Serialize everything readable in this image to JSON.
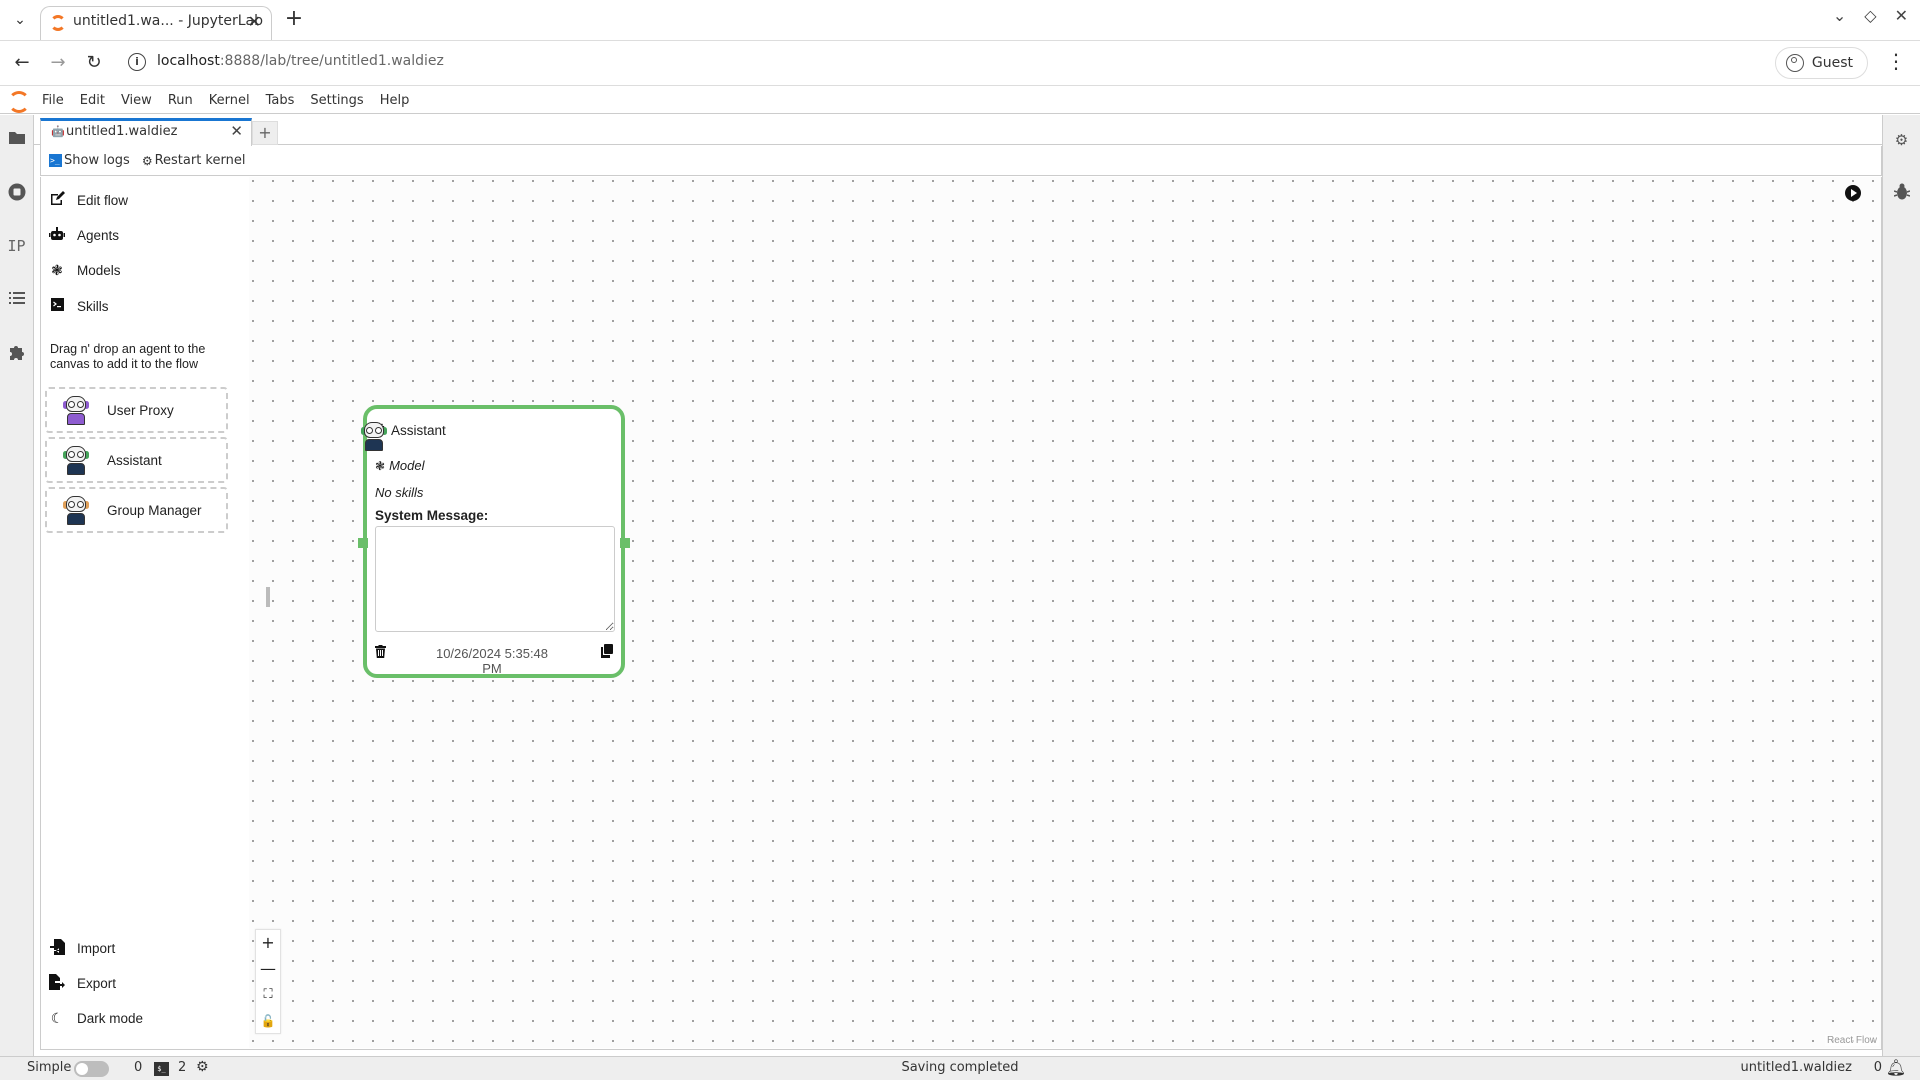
{
  "browser": {
    "tab_title": "untitled1.wa... - JupyterLab",
    "url_host": "localhost",
    "url_rest": ":8888/lab/tree/untitled1.waldiez",
    "profile_label": "Guest",
    "icons": {
      "tab_list": "chevron-down-icon",
      "close_tab": "close-icon",
      "new_tab": "plus-icon",
      "back": "arrow-left-icon",
      "forward": "arrow-right-icon",
      "reload": "reload-icon",
      "site_info": "info-icon",
      "menu": "kebab-menu-icon"
    },
    "window_controls": [
      "minimize-icon",
      "restore-icon",
      "close-icon"
    ]
  },
  "jupyter": {
    "menu": [
      "File",
      "Edit",
      "View",
      "Run",
      "Kernel",
      "Tabs",
      "Settings",
      "Help"
    ],
    "left_sidebar_icons": [
      "folder-icon",
      "stop-circle-icon",
      "ip-icon",
      "list-icon",
      "puzzle-icon"
    ],
    "left_sidebar_ip_text": "IP",
    "right_sidebar_icons": [
      "property-inspector-icon",
      "debugger-icon"
    ],
    "doc_tab": {
      "label": "untitled1.waldiez",
      "add_label": "+"
    },
    "toolbar": {
      "show_logs": "Show logs",
      "restart_kernel": "Restart kernel"
    }
  },
  "waldiez": {
    "sidebar": {
      "items": [
        {
          "label": "Edit flow",
          "icon": "edit-icon"
        },
        {
          "label": "Agents",
          "icon": "robot-icon"
        },
        {
          "label": "Models",
          "icon": "openai-icon"
        },
        {
          "label": "Skills",
          "icon": "terminal-icon"
        }
      ],
      "drag_hint": "Drag n' drop an agent to the canvas to add it to the flow",
      "agents": [
        {
          "label": "User Proxy",
          "accent": "#8e5cd0"
        },
        {
          "label": "Assistant",
          "accent": "#45a35a"
        },
        {
          "label": "Group Manager",
          "accent": "#e0a05a"
        }
      ],
      "bottom_items": [
        {
          "label": "Import",
          "icon": "file-import-icon"
        },
        {
          "label": "Export",
          "icon": "file-export-icon"
        },
        {
          "label": "Dark mode",
          "icon": "moon-icon"
        }
      ]
    },
    "node": {
      "title": "Assistant",
      "model_label": "Model",
      "skills_label": "No skills",
      "system_message_label": "System Message:",
      "system_message_value": "",
      "created": "10/26/2024 5:35:48 PM",
      "border_color": "#6abf69"
    },
    "zoom_controls": [
      "zoom-in-icon",
      "zoom-out-icon",
      "fit-view-icon",
      "lock-icon"
    ],
    "attribution": "React Flow"
  },
  "statusbar": {
    "mode_label": "Simple",
    "simple_mode_on": false,
    "kernels_count": "0",
    "terminals_count": "2",
    "status": "Saving completed",
    "filename": "untitled1.waldiez",
    "notifications_count": "0"
  }
}
